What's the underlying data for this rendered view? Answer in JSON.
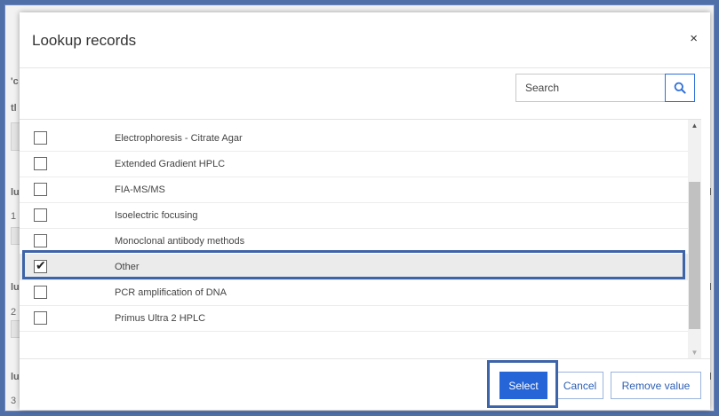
{
  "dialog": {
    "title": "Lookup records",
    "close_symbol": "×"
  },
  "search": {
    "placeholder": "Search",
    "value": ""
  },
  "items": [
    {
      "label": "Electrophoresis - Citrate Agar",
      "checked": false
    },
    {
      "label": "Extended Gradient HPLC",
      "checked": false
    },
    {
      "label": "FIA-MS/MS",
      "checked": false
    },
    {
      "label": "Isoelectric focusing",
      "checked": false
    },
    {
      "label": "Monoclonal antibody methods",
      "checked": false
    },
    {
      "label": "Other",
      "checked": true
    },
    {
      "label": "PCR amplification of DNA",
      "checked": false
    },
    {
      "label": "Primus Ultra 2 HPLC",
      "checked": false
    }
  ],
  "footer": {
    "select_label": "Select",
    "cancel_label": "Cancel",
    "remove_label": "Remove value"
  },
  "background": {
    "fragments": [
      "'c",
      "tl",
      "lu",
      "1",
      "lu",
      "2",
      "lu",
      "3",
      "d",
      "d",
      "d"
    ]
  },
  "colors": {
    "accent": "#2565d8",
    "highlight_border": "#3d63a8",
    "selected_row": "#ebebeb"
  }
}
